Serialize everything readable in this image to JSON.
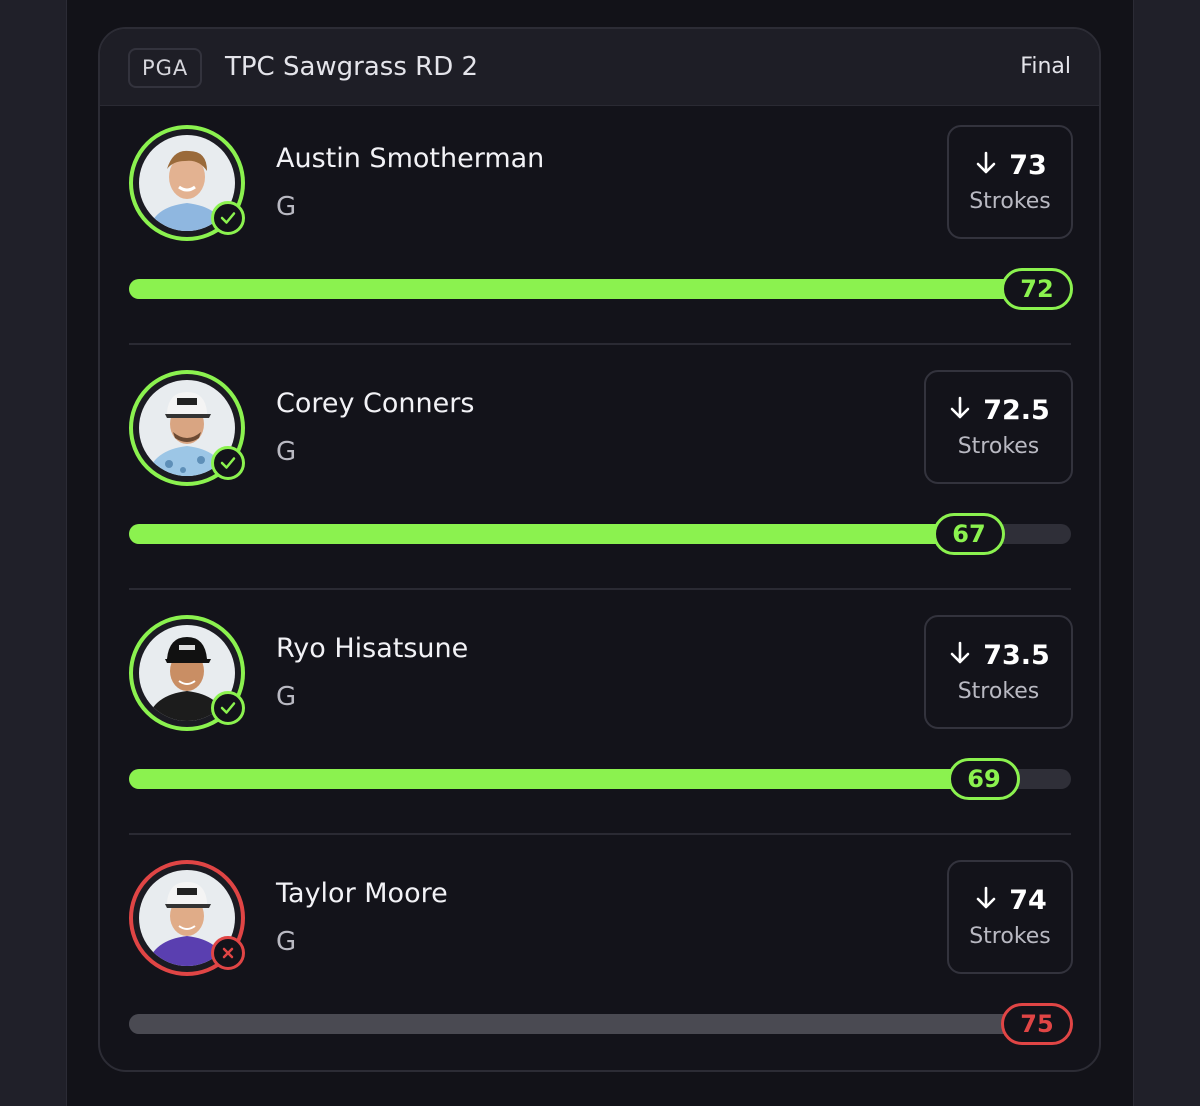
{
  "header": {
    "league": "PGA",
    "event": "TPC Sawgrass RD 2",
    "status": "Final"
  },
  "colors": {
    "hit": "#8bf24f",
    "miss": "#e04545",
    "background": "#13131a"
  },
  "players": [
    {
      "name": "Austin Smotherman",
      "position": "G",
      "line": "73",
      "stat_label": "Strokes",
      "direction": "under",
      "result": "72",
      "outcome": "hit",
      "progress_fraction": 1.0,
      "status_icon": "check-icon"
    },
    {
      "name": "Corey Conners",
      "position": "G",
      "line": "72.5",
      "stat_label": "Strokes",
      "direction": "under",
      "result": "67",
      "outcome": "hit",
      "progress_fraction": 0.924,
      "status_icon": "check-icon"
    },
    {
      "name": "Ryo Hisatsune",
      "position": "G",
      "line": "73.5",
      "stat_label": "Strokes",
      "direction": "under",
      "result": "69",
      "outcome": "hit",
      "progress_fraction": 0.939,
      "status_icon": "check-icon"
    },
    {
      "name": "Taylor Moore",
      "position": "G",
      "line": "74",
      "stat_label": "Strokes",
      "direction": "under",
      "result": "75",
      "outcome": "miss",
      "progress_fraction": 1.0,
      "status_icon": "x-icon"
    }
  ]
}
